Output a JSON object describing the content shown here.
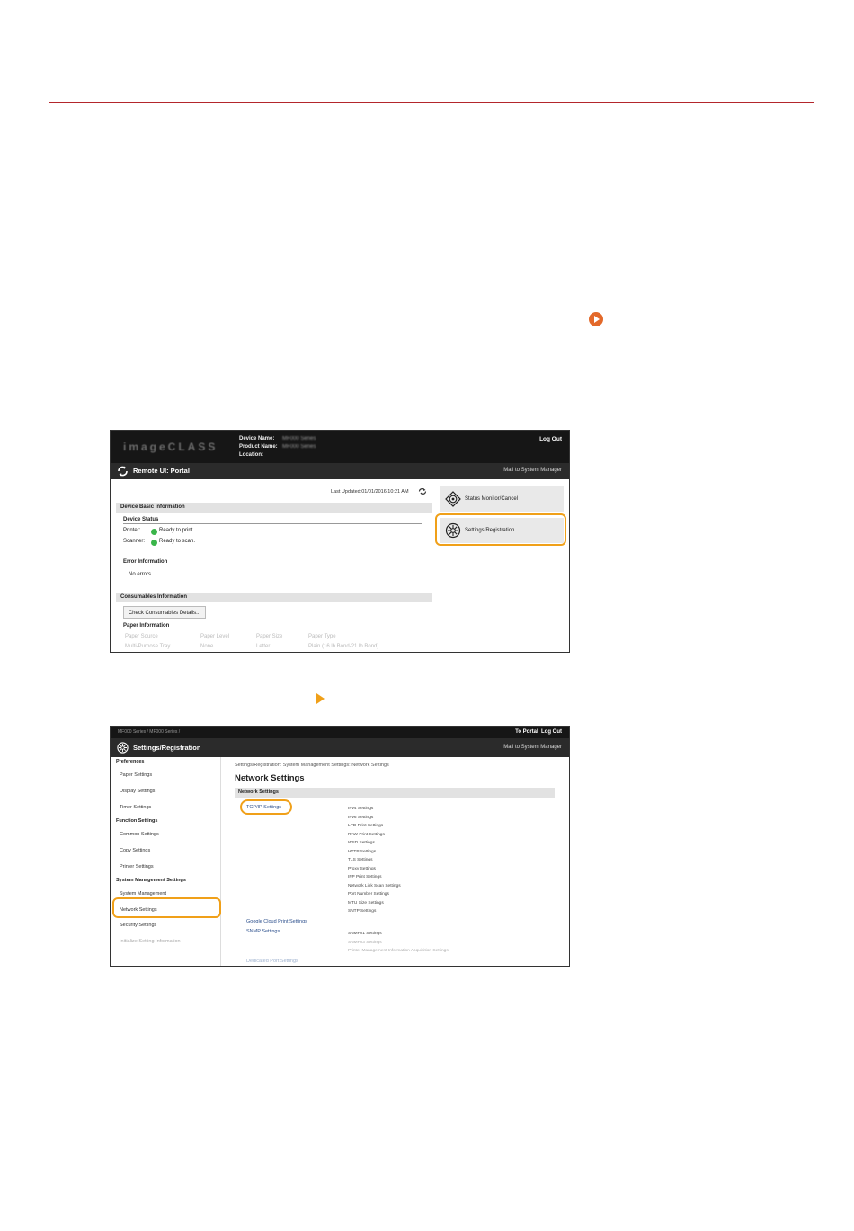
{
  "shot1": {
    "brand": "imageCLASS",
    "device_labels": [
      "Device Name:",
      "Product Name:",
      "Location:"
    ],
    "device_values": [
      "MF000 Series",
      "MF000 Series",
      ""
    ],
    "logout": "Log Out",
    "portal_title": "Remote UI: Portal",
    "mail": "Mail to System Manager",
    "last_updated": "Last Updated:01/01/2016 10:21 AM",
    "device_basic": "Device Basic Information",
    "device_status": "Device Status",
    "printer_label": "Printer:",
    "printer_status": "Ready to print.",
    "scanner_label": "Scanner:",
    "scanner_status": "Ready to scan.",
    "error_info": "Error Information",
    "no_errors": "No errors.",
    "consumables": "Consumables Information",
    "check_button": "Check Consumables Details...",
    "paper_info": "Paper Information",
    "paper_cols": [
      "Paper Source",
      "Paper Level",
      "Paper Size",
      "Paper Type"
    ],
    "paper_row": [
      "Multi-Purpose Tray",
      "None",
      "Letter",
      "Plain (16 lb Bond-21 lb Bond)"
    ],
    "status_monitor": "Status Monitor/Cancel",
    "settings_reg": "Settings/Registration"
  },
  "shot2": {
    "crumb": "MF000 Series / MF000 Series /",
    "to_portal": "To Portal",
    "logout": "Log Out",
    "title": "Settings/Registration",
    "mail": "Mail to System Manager",
    "nav": {
      "preferences": "Preferences",
      "paper_settings": "Paper Settings",
      "display_settings": "Display Settings",
      "timer_settings": "Timer Settings",
      "function_settings": "Function Settings",
      "common_settings": "Common Settings",
      "copy_settings": "Copy Settings",
      "printer_settings": "Printer Settings",
      "system_mgmt_settings": "System Management Settings",
      "system_management": "System Management",
      "network_settings": "Network Settings",
      "security_settings": "Security Settings",
      "initialize": "Initialize Setting Information"
    },
    "path": "Settings/Registration: System Management Settings: Network Settings",
    "heading": "Network Settings",
    "band": "Network Settings",
    "tcpip": "TCP/IP Settings",
    "tcpip_subs": [
      "IPv4 Settings",
      "IPv6 Settings",
      "LPD Print Settings",
      "RAW Print Settings",
      "WSD Settings",
      "HTTP Settings",
      "TLS Settings",
      "Proxy Settings",
      "IPP Print Settings",
      "Network Link Scan Settings",
      "Port Number Settings",
      "MTU Size Settings",
      "SNTP Settings"
    ],
    "google": "Google Cloud Print Settings",
    "snmp": "SNMP Settings",
    "snmp_subs": [
      "SNMPv1 Settings",
      "SNMPv3 Settings",
      "Printer Management Information Acquisition Settings"
    ],
    "dedicated": "Dedicated Port Settings"
  }
}
